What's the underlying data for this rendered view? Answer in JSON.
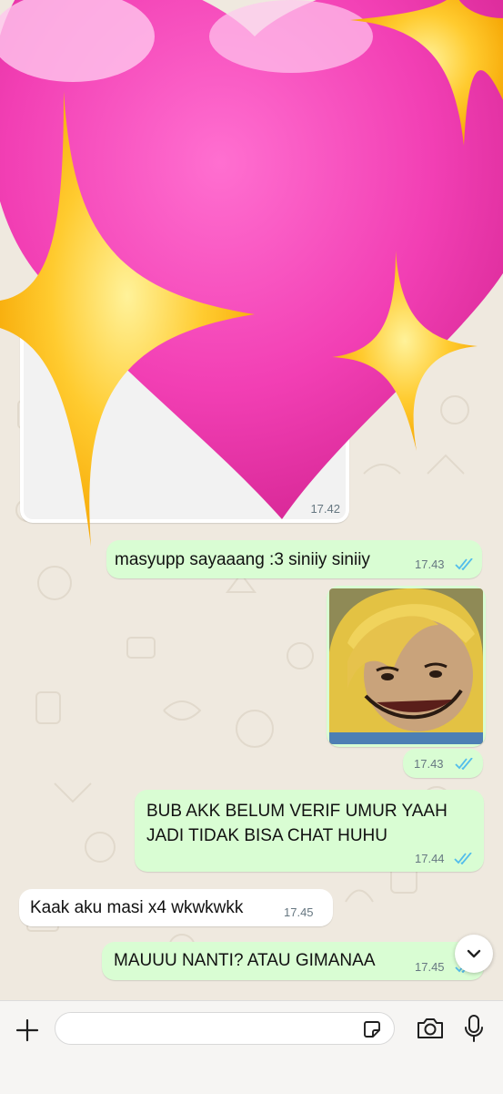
{
  "chat": {
    "messages": [
      {
        "type": "image",
        "direction": "in",
        "time": "17.42"
      },
      {
        "type": "text",
        "direction": "out",
        "text": "masyupp sayaaang :3 siniiy siniiy",
        "time": "17.43",
        "status": "read"
      },
      {
        "type": "image",
        "direction": "out",
        "time": "17.43",
        "status": "read"
      },
      {
        "type": "text",
        "direction": "out",
        "line1": "BUB AKK BELUM VERIF UMUR YAAH",
        "line2": "JADI TIDAK BISA CHAT HUHU",
        "time": "17.44",
        "status": "read"
      },
      {
        "type": "text",
        "direction": "in",
        "text": "Kaak aku masi x4 wkwkwkk",
        "time": "17.45"
      },
      {
        "type": "text",
        "direction": "out",
        "text": "MAUUU NANTI? ATAU GIMANAA",
        "time": "17.45",
        "status": "read"
      }
    ]
  },
  "composer": {
    "placeholder": "",
    "icons": [
      "plus-icon",
      "sticker-icon",
      "camera-icon",
      "microphone-icon"
    ]
  },
  "scroll_button": {
    "icon": "chevron-down-icon"
  },
  "colors": {
    "outgoing_bubble": "#d9fdd3",
    "incoming_bubble": "#ffffff",
    "read_ticks": "#53bdeb",
    "wallpaper": "#efe9df"
  }
}
